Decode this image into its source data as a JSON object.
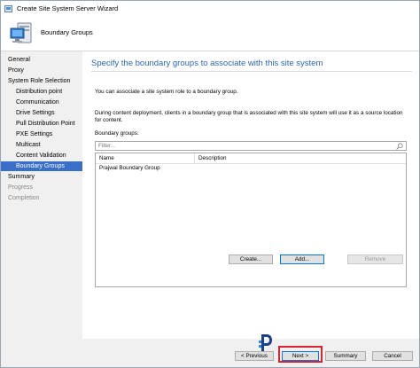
{
  "window": {
    "title": "Create Site System Server Wizard"
  },
  "header": {
    "title": "Boundary Groups"
  },
  "nav": {
    "items": [
      {
        "label": "General",
        "level": 1,
        "state": "normal"
      },
      {
        "label": "Proxy",
        "level": 1,
        "state": "normal"
      },
      {
        "label": "System Role Selection",
        "level": 1,
        "state": "normal"
      },
      {
        "label": "Distribution point",
        "level": 2,
        "state": "normal"
      },
      {
        "label": "Communication",
        "level": 2,
        "state": "normal"
      },
      {
        "label": "Drive Settings",
        "level": 2,
        "state": "normal"
      },
      {
        "label": "Pull Distribution Point",
        "level": 2,
        "state": "normal"
      },
      {
        "label": "PXE Settings",
        "level": 2,
        "state": "normal"
      },
      {
        "label": "Multicast",
        "level": 2,
        "state": "normal"
      },
      {
        "label": "Content Validation",
        "level": 2,
        "state": "normal"
      },
      {
        "label": "Boundary Groups",
        "level": 2,
        "state": "active"
      },
      {
        "label": "Summary",
        "level": 1,
        "state": "normal"
      },
      {
        "label": "Progress",
        "level": 1,
        "state": "disabled"
      },
      {
        "label": "Completion",
        "level": 1,
        "state": "disabled"
      }
    ]
  },
  "main": {
    "title": "Specify the boundary groups to associate with this site system",
    "intro": "You can associate a site system role to a boundary group.",
    "description": "During content deployment, clients in a boundary group that is associated with this site system will use it as a source location for content.",
    "boundary_groups_label": "Boundary groups:",
    "filter_placeholder": "Filter...",
    "columns": {
      "name": "Name",
      "description": "Description"
    },
    "rows": [
      {
        "name": "Prajwal Boundary Group",
        "description": ""
      }
    ],
    "buttons": {
      "create": "Create...",
      "add": "Add...",
      "remove": "Remove"
    }
  },
  "footer": {
    "previous": "< Previous",
    "next": "Next >",
    "summary": "Summary",
    "cancel": "Cancel"
  },
  "colors": {
    "accent": "#2a66b4",
    "selection": "#3a6fc9",
    "highlight": "#d9232e"
  }
}
